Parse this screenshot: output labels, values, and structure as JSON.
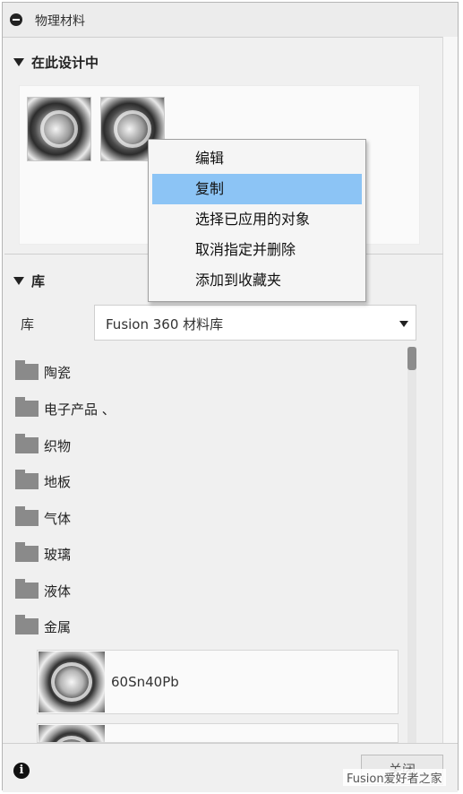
{
  "panel": {
    "title": "物理材料"
  },
  "design_section": {
    "header": "在此设计中",
    "swatches": [
      {
        "name": "material-swatch-1"
      },
      {
        "name": "material-swatch-2"
      }
    ]
  },
  "context_menu": {
    "items": [
      {
        "label": "编辑",
        "highlighted": false
      },
      {
        "label": "复制",
        "highlighted": true
      },
      {
        "label": "选择已应用的对象",
        "highlighted": false
      },
      {
        "label": "取消指定并删除",
        "highlighted": false
      },
      {
        "label": "添加到收藏夹",
        "highlighted": false
      }
    ],
    "highlight_color": "#8cc4f5"
  },
  "library_section": {
    "header": "库",
    "select_label": "库",
    "select_value": "Fusion 360 材料库",
    "folders": [
      {
        "label": "陶瓷"
      },
      {
        "label": "电子产品 、"
      },
      {
        "label": "织物"
      },
      {
        "label": "地板"
      },
      {
        "label": "气体"
      },
      {
        "label": "玻璃"
      },
      {
        "label": "液体"
      },
      {
        "label": "金属"
      }
    ],
    "materials": [
      {
        "label": "60Sn40Pb"
      },
      {
        "label": ""
      }
    ]
  },
  "footer": {
    "close_label": "关闭",
    "watermark": "Fusion爱好者之家"
  },
  "icons": {
    "collapse": "collapse-icon",
    "triangle": "triangle-down-icon",
    "folder": "folder-icon",
    "info": "info-icon",
    "dropdown": "chevron-down-icon"
  }
}
